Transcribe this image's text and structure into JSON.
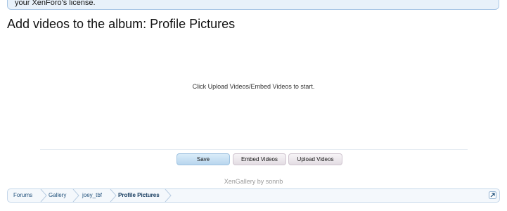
{
  "notice": {
    "text": "your XenForo's license."
  },
  "page": {
    "title": "Add videos to the album: Profile Pictures",
    "empty_message": "Click Upload Videos/Embed Videos to start."
  },
  "actions": {
    "save_label": "Save",
    "embed_label": "Embed Videos",
    "upload_label": "Upload Videos"
  },
  "footer": {
    "credit": "XenGallery by sonnb"
  },
  "breadcrumb": {
    "items": [
      "Forums",
      "Gallery",
      "joey_tbf",
      "Profile Pictures"
    ],
    "jump_icon": "jump-arrow-icon"
  },
  "colors": {
    "save_bg": "#c9e2f4",
    "secondary_bg": "#ece7ec",
    "breadcrumb_border": "#c5d7ea",
    "link": "#1f4f7a"
  }
}
